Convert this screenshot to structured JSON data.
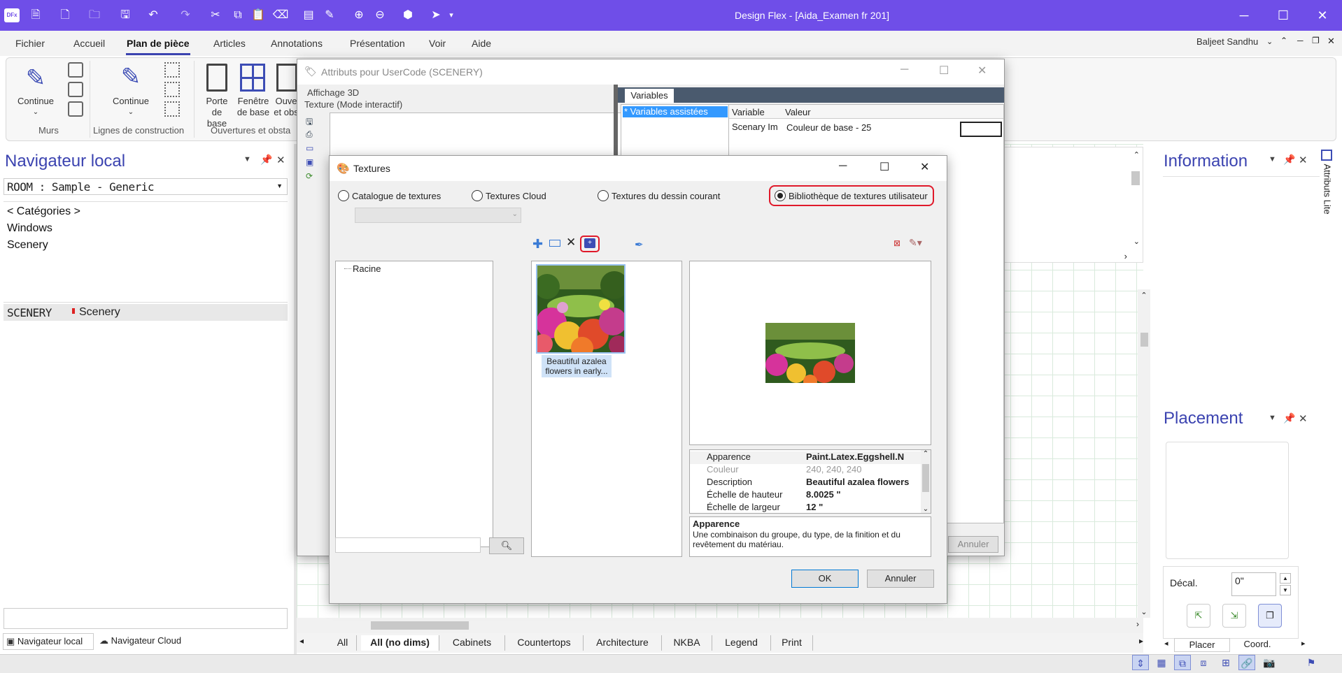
{
  "app": {
    "title": "Design Flex - [Aida_Examen fr 201]",
    "logo": "DFx"
  },
  "menu": {
    "items": [
      "Fichier",
      "Accueil",
      "Plan de pièce",
      "Articles",
      "Annotations",
      "Présentation",
      "Voir",
      "Aide"
    ],
    "active_index": 2
  },
  "user": {
    "name": "Baljeet Sandhu"
  },
  "ribbon": {
    "walls": {
      "continue_label": "Continue",
      "group_label": "Murs"
    },
    "construction": {
      "continue_label": "Continue",
      "group_label": "Lignes de construction"
    },
    "openings": {
      "door_label": "Porte de base",
      "window_label": "Fenêtre de base",
      "other_label": "Ouve et obs",
      "group_label": "Ouvertures et obsta"
    }
  },
  "local_nav": {
    "title": "Navigateur local",
    "room_select": "ROOM : Sample - Generic",
    "categories_label": "< Catégories >",
    "items": [
      "Windows",
      "Scenery"
    ],
    "selected": {
      "code": "SCENERY",
      "name": "Scenery"
    },
    "bottom_tabs": [
      "Navigateur local",
      "Navigateur Cloud"
    ]
  },
  "information": {
    "title": "Information",
    "side_tab": "Attributs Lite"
  },
  "placement": {
    "title": "Placement",
    "decal_label": "Décal.",
    "decal_value": "0\"",
    "tabs": [
      "Placer",
      "Coord."
    ]
  },
  "attr_dialog": {
    "title": "Attributs pour UserCode (SCENERY)",
    "tree_items": [
      "Affichage 3D",
      "Texture (Mode interactif)"
    ],
    "variables_tab": "Variables",
    "assisted_item": "* Variables assistées",
    "col_variable": "Variable",
    "col_value": "Valeur",
    "row_variable": "Scenary Im",
    "row_value": "Couleur de base - 25",
    "cancel_label": "Annuler"
  },
  "textures_dialog": {
    "title": "Textures",
    "radios": [
      "Catalogue de textures",
      "Textures Cloud",
      "Textures du dessin courant",
      "Bibliothèque de textures utilisateur"
    ],
    "selected_radio": 3,
    "tree_root": "Racine",
    "thumbnail_caption": "Beautiful azalea flowers in early...",
    "properties": [
      {
        "key": "Apparence",
        "value": "Paint.Latex.Eggshell.N"
      },
      {
        "key": "Couleur",
        "value": "240, 240, 240"
      },
      {
        "key": "Description",
        "value": "Beautiful azalea flowers"
      },
      {
        "key": "Échelle de hauteur",
        "value": "8.0025 \""
      },
      {
        "key": "Échelle de largeur",
        "value": "12 \""
      }
    ],
    "desc_title": "Apparence",
    "desc_text": "Une combinaison du groupe, du type, de la finition et du revêtement du matériau.",
    "ok_label": "OK",
    "cancel_label": "Annuler"
  },
  "bottom_tabs": [
    "All",
    "All (no dims)",
    "Cabinets",
    "Countertops",
    "Architecture",
    "NKBA",
    "Legend",
    "Print"
  ],
  "bottom_tabs_active": 1,
  "colors": {
    "titlebar": "#6f4ee8",
    "accent": "#3b43b0",
    "highlight_red": "#e0192a",
    "selection": "#3399ff"
  }
}
